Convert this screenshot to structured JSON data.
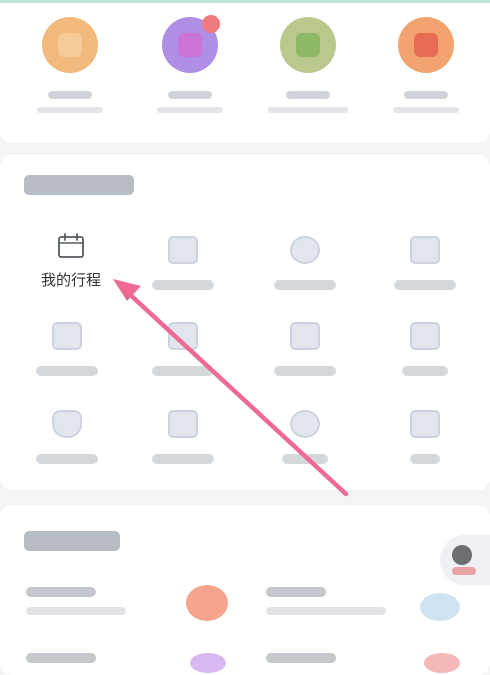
{
  "tools": {
    "focused_item": {
      "label": "我的行程",
      "icon": "calendar-icon"
    }
  },
  "colors": {
    "arrow": "#ee6a93",
    "focused_text": "#333333"
  }
}
